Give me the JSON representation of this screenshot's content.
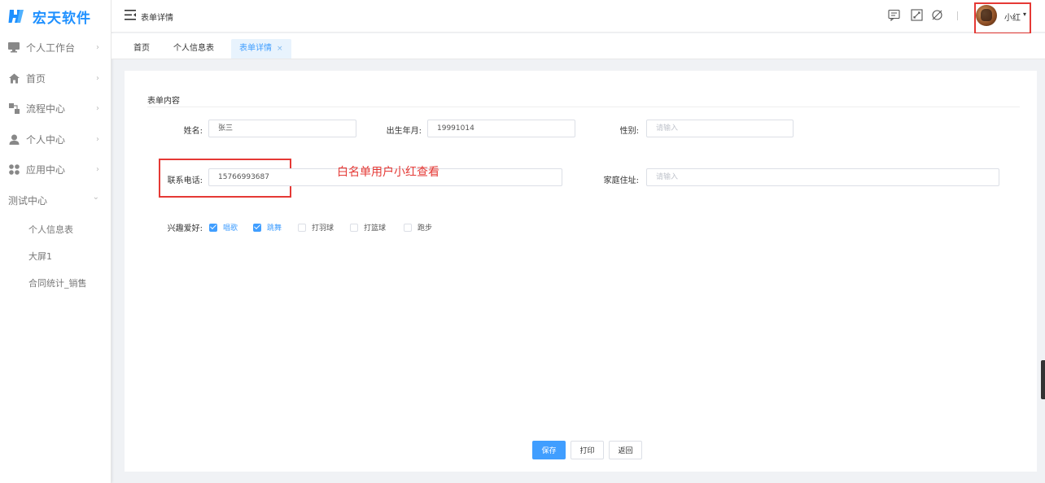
{
  "brand": {
    "name": "宏天软件"
  },
  "sidebar": {
    "items": [
      {
        "label": "个人工作台",
        "icon": "monitor-icon",
        "arrow": "›"
      },
      {
        "label": "首页",
        "icon": "home-icon",
        "arrow": "›"
      },
      {
        "label": "流程中心",
        "icon": "flow-icon",
        "arrow": "›"
      },
      {
        "label": "个人中心",
        "icon": "user-icon",
        "arrow": "›"
      },
      {
        "label": "应用中心",
        "icon": "apps-icon",
        "arrow": "›"
      },
      {
        "label": "测试中心",
        "arrow": "⌄"
      }
    ],
    "sub_items": [
      "个人信息表",
      "大屏1",
      "合同统计_销售"
    ]
  },
  "header": {
    "title": "表单详情",
    "icons": [
      "message-icon",
      "fullscreen-icon",
      "theme-icon"
    ],
    "user": {
      "name": "小红",
      "caret": "▾"
    }
  },
  "tabs": [
    {
      "label": "首页"
    },
    {
      "label": "个人信息表"
    },
    {
      "label": "表单详情",
      "active": true,
      "close": "×"
    }
  ],
  "form": {
    "section_title": "表单内容",
    "name_label": "姓名:",
    "name_value": "张三",
    "birth_label": "出生年月:",
    "birth_value": "19991014",
    "gender_label": "性别:",
    "gender_placeholder": "请输入",
    "phone_label": "联系电话:",
    "phone_value": "15766993687",
    "address_label": "家庭住址:",
    "address_placeholder": "请输入",
    "hobby_label": "兴趣爱好:",
    "hobbies": [
      {
        "label": "唱歌",
        "checked": true
      },
      {
        "label": "跳舞",
        "checked": true
      },
      {
        "label": "打羽球",
        "checked": false
      },
      {
        "label": "打篮球",
        "checked": false
      },
      {
        "label": "跑步",
        "checked": false
      }
    ],
    "annotation": "白名单用户小红查看"
  },
  "buttons": {
    "save": "保存",
    "print": "打印",
    "back": "返回"
  },
  "colors": {
    "primary": "#409eff",
    "brand": "#1e90ff",
    "highlight": "#e53935"
  }
}
